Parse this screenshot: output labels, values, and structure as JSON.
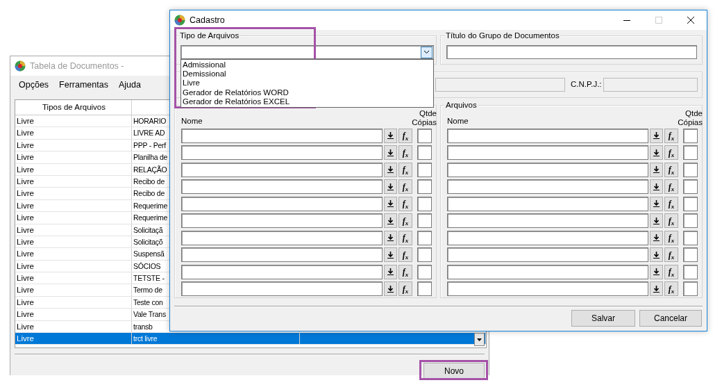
{
  "back_window": {
    "title": "Tabela de Documentos -",
    "menu": [
      "Opções",
      "Ferramentas",
      "Ajuda"
    ],
    "table": {
      "columns": [
        "Tipos de Arquivos"
      ],
      "rows": [
        {
          "cells": [
            "Livre",
            "HORARIO"
          ],
          "selected": false
        },
        {
          "cells": [
            "Livre",
            "LIVRE AD"
          ],
          "selected": false
        },
        {
          "cells": [
            "Livre",
            "PPP - Perf"
          ],
          "selected": false
        },
        {
          "cells": [
            "Livre",
            "Planilha de"
          ],
          "selected": false
        },
        {
          "cells": [
            "Livre",
            "RELAÇÃO"
          ],
          "selected": false
        },
        {
          "cells": [
            "Livre",
            "Recibo de"
          ],
          "selected": false
        },
        {
          "cells": [
            "Livre",
            "Recibo de"
          ],
          "selected": false
        },
        {
          "cells": [
            "Livre",
            "Requerime"
          ],
          "selected": false
        },
        {
          "cells": [
            "Livre",
            "Requerime"
          ],
          "selected": false
        },
        {
          "cells": [
            "Livre",
            "Solicitaçã"
          ],
          "selected": false
        },
        {
          "cells": [
            "Livre",
            "Solicitaçõ"
          ],
          "selected": false
        },
        {
          "cells": [
            "Livre",
            "Suspensã"
          ],
          "selected": false
        },
        {
          "cells": [
            "Livre",
            "SÓCIOS"
          ],
          "selected": false
        },
        {
          "cells": [
            "Livre",
            "TETSTE -"
          ],
          "selected": false
        },
        {
          "cells": [
            "Livre",
            "Termo de"
          ],
          "selected": false
        },
        {
          "cells": [
            "Livre",
            "Teste con"
          ],
          "selected": false
        },
        {
          "cells": [
            "Livre",
            "Vale Trans"
          ],
          "selected": false
        },
        {
          "cells": [
            "Livre",
            "transb"
          ],
          "selected": false
        },
        {
          "cells": [
            "Livre",
            "trct livre"
          ],
          "selected": true
        }
      ]
    },
    "buttons": [
      {
        "label": "Novo",
        "highlighted": true
      }
    ]
  },
  "dialog": {
    "title": "Cadastro",
    "tipo_group": {
      "legend": "Tipo de Arquivos",
      "highlighted": true,
      "dropdown": {
        "expanded": true,
        "options": [
          "Admissional",
          "Demissional",
          "Livre",
          "Gerador de Relatórios WORD",
          "Gerador de Relatórios EXCEL"
        ]
      }
    },
    "titulo_group": {
      "legend": "Título do Grupo de Documentos"
    },
    "cnpj_label": "C.N.P.J.:",
    "file_groups": [
      {
        "name_label": "Nome",
        "copies_label": "Qtde Cópias",
        "rows": [
          {
            "kind": "file",
            "formula_button": "f$_{x}$"
          },
          {
            "kind": "file",
            "formula_button": "f$_{x}$"
          },
          {
            "kind": "file",
            "formula_button": "f$_{x}$"
          },
          {
            "kind": "file",
            "formula_button": "f$_{x}$"
          },
          {
            "kind": "file",
            "formula_button": "f$_{x}$"
          },
          {
            "kind": "file",
            "formula_button": "f$_{x}$"
          },
          {
            "kind": "file",
            "formula_button": "f$_{x}$"
          },
          {
            "kind": "file",
            "formula_button": "f$_{x}$"
          },
          {
            "kind": "file",
            "formula_button": "f$_{x}$"
          },
          {
            "kind": "file",
            "formula_button": "f$_{x}$"
          }
        ]
      },
      {
        "legend": "Arquivos",
        "name_label": "Nome",
        "copies_label": "Qtde Cópias",
        "rows": [
          {
            "kind": "file",
            "formula_button": "f$_{x}$"
          },
          {
            "kind": "file",
            "formula_button": "f$_{x}$"
          },
          {
            "kind": "file",
            "formula_button": "f$_{x}$"
          },
          {
            "kind": "file",
            "formula_button": "f$_{x}$"
          },
          {
            "kind": "file",
            "formula_button": "f$_{x}$"
          },
          {
            "kind": "file",
            "formula_button": "f$_{x}$"
          },
          {
            "kind": "file",
            "formula_button": "f$_{x}$"
          },
          {
            "kind": "file",
            "formula_button": "f$_{x}$"
          },
          {
            "kind": "file",
            "formula_button": "f$_{x}$"
          },
          {
            "kind": "file",
            "formula_button": "f$_{x}$"
          }
        ]
      }
    ],
    "buttons": [
      {
        "label": "Salvar"
      },
      {
        "label": "Cancelar"
      }
    ]
  }
}
